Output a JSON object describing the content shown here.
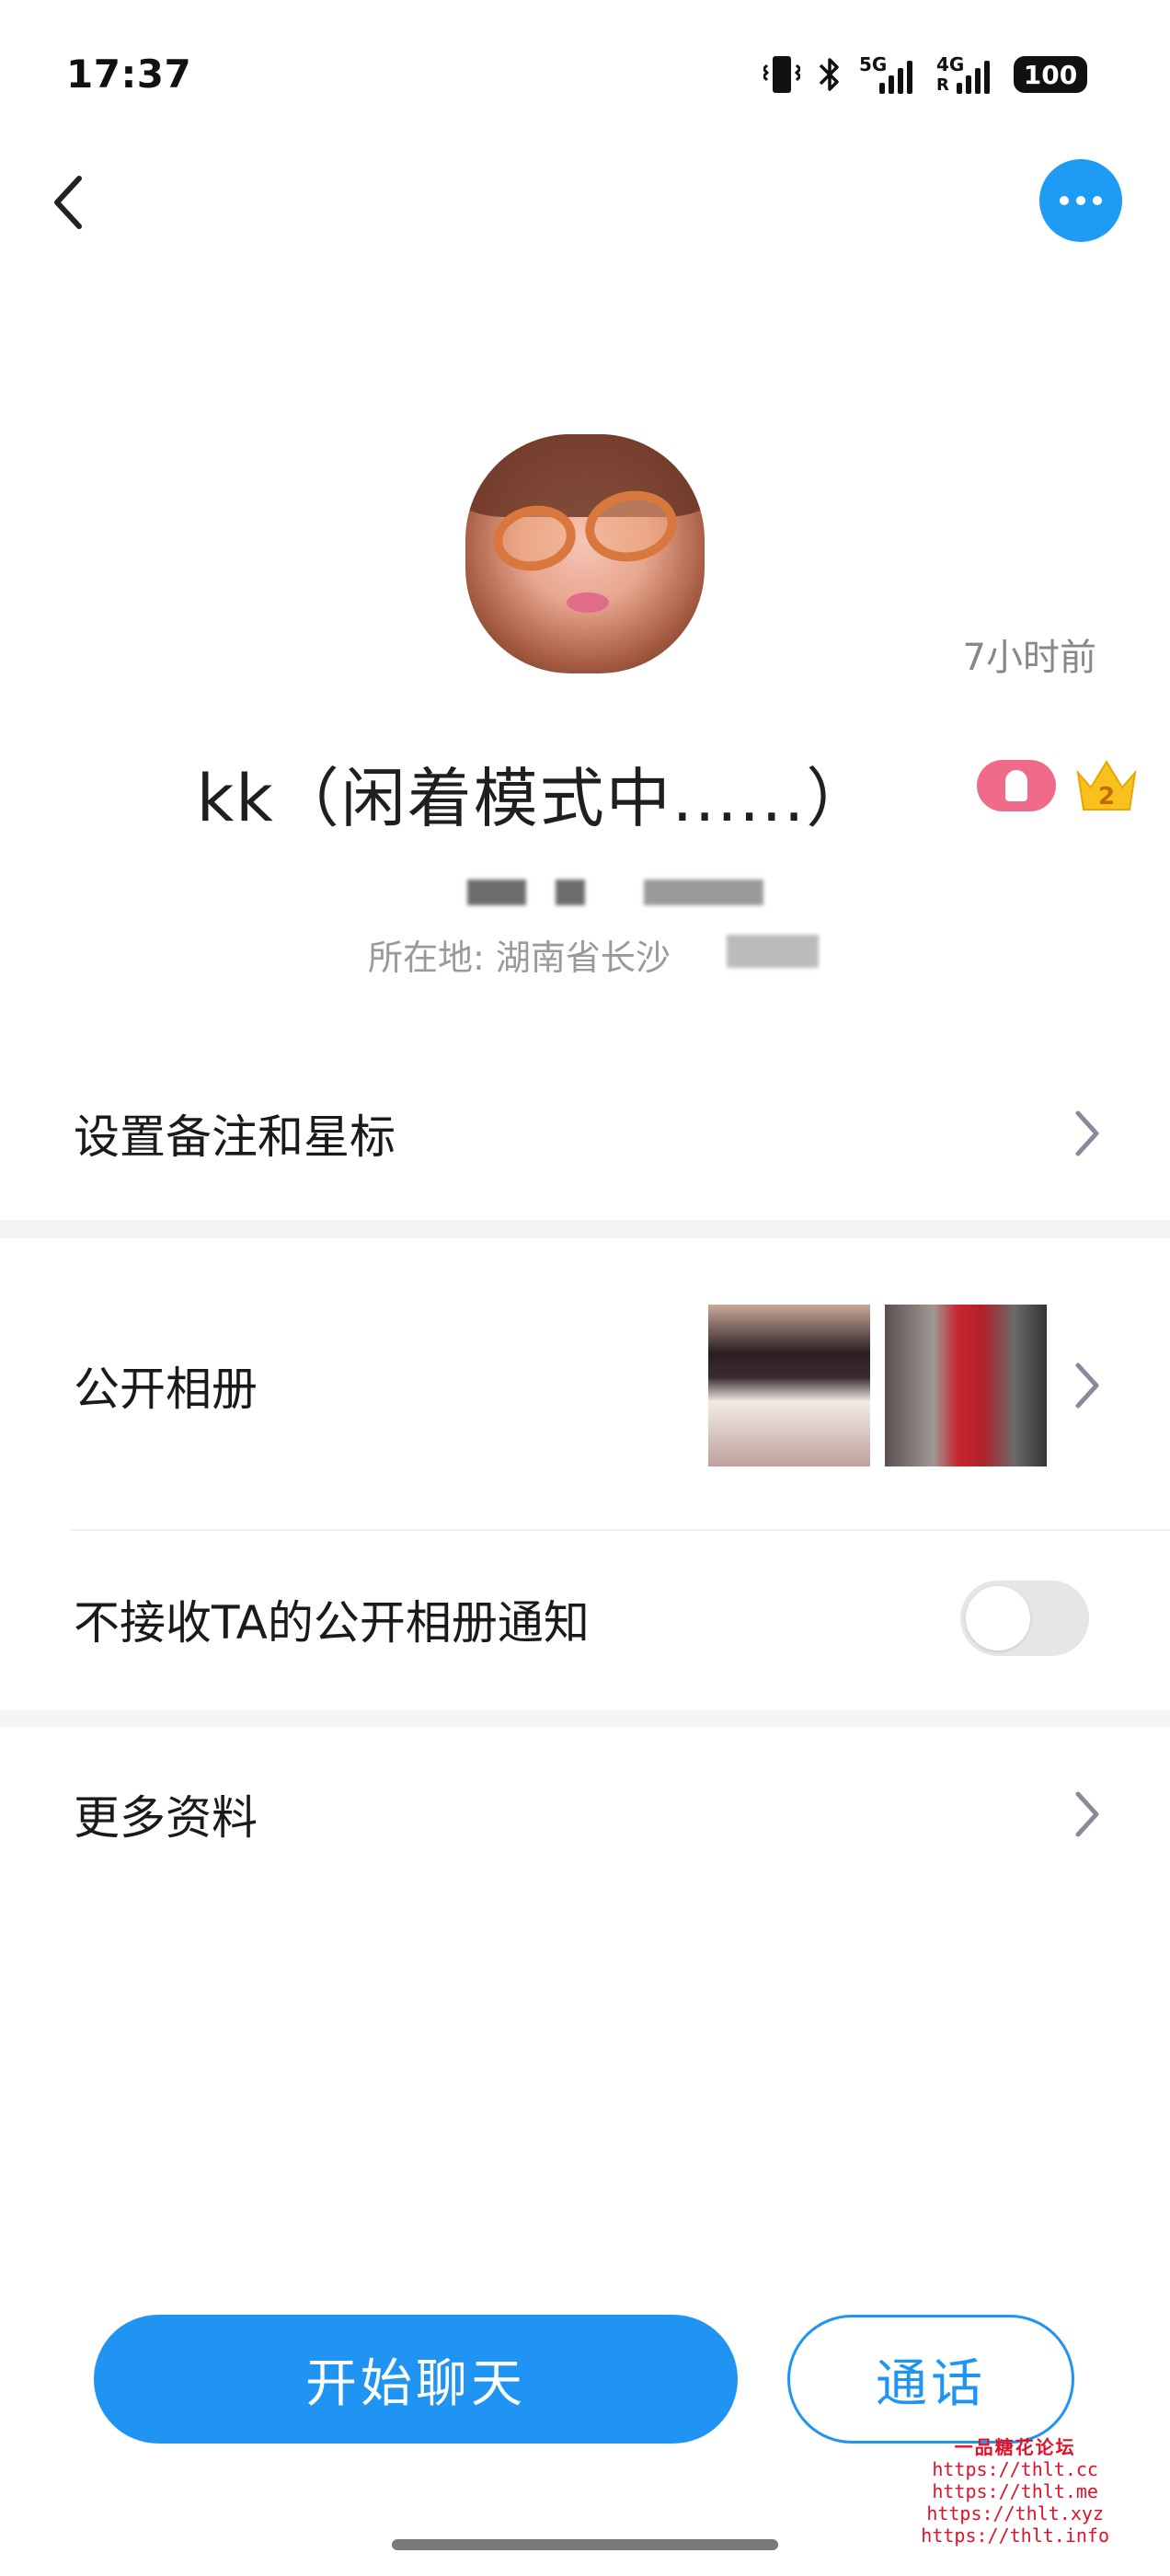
{
  "status_bar": {
    "time": "17:37",
    "network_1": "5G",
    "network_2": "4G",
    "roaming": "R",
    "battery": "100",
    "icons": [
      "vibrate-icon",
      "bluetooth-icon",
      "signal-5g-icon",
      "signal-4g-icon",
      "battery-icon"
    ]
  },
  "nav": {
    "back_icon": "chevron-left-icon",
    "more_icon": "more-dots-icon",
    "accent": "#1e9bf5"
  },
  "profile": {
    "last_active": "7小时前",
    "nickname": "kk（闲着模式中......）",
    "location_prefix": "所在地: 湖南省长沙",
    "badges": [
      "user-badge-icon",
      "crown-level-icon"
    ],
    "crown_level": "2"
  },
  "rows": {
    "remark": {
      "label": "设置备注和星标"
    },
    "album": {
      "label": "公开相册"
    },
    "album_notify": {
      "label": "不接收TA的公开相册通知",
      "enabled": false
    },
    "more_info": {
      "label": "更多资料"
    }
  },
  "actions": {
    "chat": "开始聊天",
    "call": "通话",
    "primary_color": "#1f94f2"
  },
  "watermark": {
    "title": "一品糖花论坛",
    "urls": [
      "https://thlt.cc",
      "https://thlt.me",
      "https://thlt.xyz",
      "https://thlt.info"
    ]
  }
}
